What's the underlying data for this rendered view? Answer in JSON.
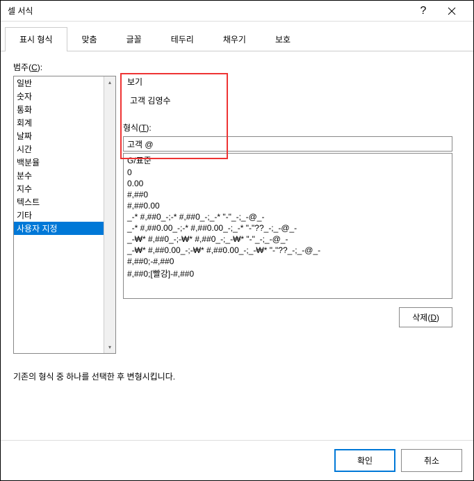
{
  "title": "셀 서식",
  "tabs": [
    {
      "label": "표시 형식",
      "active": true
    },
    {
      "label": "맞춤",
      "active": false
    },
    {
      "label": "글꼴",
      "active": false
    },
    {
      "label": "테두리",
      "active": false
    },
    {
      "label": "채우기",
      "active": false
    },
    {
      "label": "보호",
      "active": false
    }
  ],
  "category": {
    "label_prefix": "범주(",
    "label_key": "C",
    "label_suffix": "):",
    "items": [
      "일반",
      "숫자",
      "통화",
      "회계",
      "날짜",
      "시간",
      "백분율",
      "분수",
      "지수",
      "텍스트",
      "기타",
      "사용자 지정"
    ],
    "selected_index": 11
  },
  "preview": {
    "label": "보기",
    "value": "고객 김영수"
  },
  "format": {
    "label_prefix": "형식(",
    "label_key": "T",
    "label_suffix": "):",
    "input_value": "고객 @",
    "list": [
      "G/표준",
      "0",
      "0.00",
      "#,##0",
      "#,##0.00",
      "_-* #,##0_-;-* #,##0_-;_-* \"-\"_-;_-@_-",
      "_-* #,##0.00_-;-* #,##0.00_-;_-* \"-\"??_-;_-@_-",
      "_-₩* #,##0_-;-₩* #,##0_-;_-₩* \"-\"_-;_-@_-",
      "_-₩* #,##0.00_-;-₩* #,##0.00_-;_-₩* \"-\"??_-;_-@_-",
      "#,##0;-#,##0",
      "#,##0;[빨강]-#,##0"
    ]
  },
  "delete_btn_prefix": "삭제(",
  "delete_btn_key": "D",
  "delete_btn_suffix": ")",
  "hint": "기존의 형식 중 하나를 선택한 후 변형시킵니다.",
  "footer": {
    "ok": "확인",
    "cancel": "취소"
  }
}
